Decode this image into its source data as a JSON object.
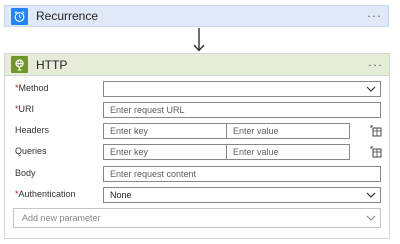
{
  "trigger": {
    "title": "Recurrence",
    "more": "···"
  },
  "action": {
    "title": "HTTP",
    "more": "···",
    "fields": {
      "method": {
        "label": "Method",
        "required": "*",
        "value": ""
      },
      "uri": {
        "label": "URI",
        "required": "*",
        "placeholder": "Enter request URL"
      },
      "headers": {
        "label": "Headers",
        "key_placeholder": "Enter key",
        "value_placeholder": "Enter value"
      },
      "queries": {
        "label": "Queries",
        "key_placeholder": "Enter key",
        "value_placeholder": "Enter value"
      },
      "body": {
        "label": "Body",
        "placeholder": "Enter request content"
      },
      "authentication": {
        "label": "Authentication",
        "required": "*",
        "value": "None"
      }
    },
    "add_parameter": "Add new parameter"
  },
  "colors": {
    "trigger_icon_bg": "#1f85ff",
    "action_icon_bg": "#709727",
    "action_header_bg": "#e5edd9",
    "trigger_bg": "#dfe9f7"
  },
  "icons": [
    "alarm-clock-icon",
    "globe-icon",
    "chevron-down-icon",
    "table-switch-icon",
    "down-arrow-icon"
  ]
}
